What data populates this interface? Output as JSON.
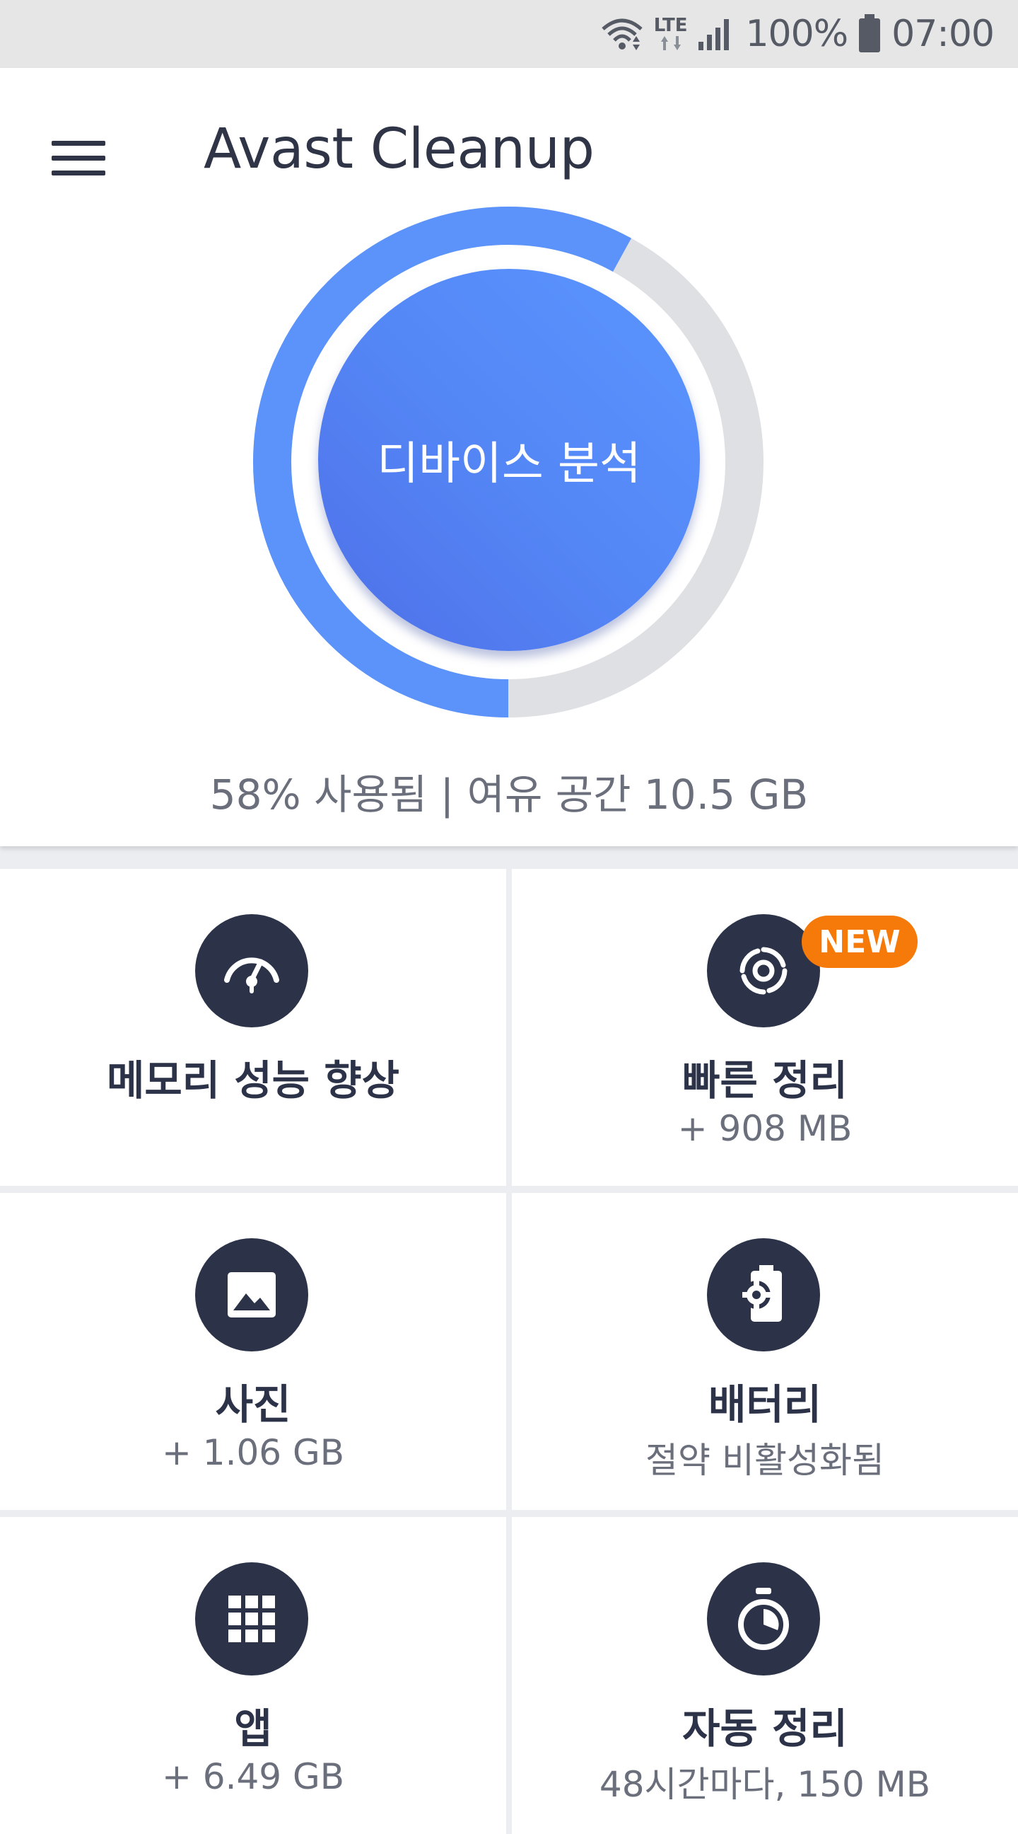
{
  "status_bar": {
    "network_label": "LTE",
    "battery_percent": "100%",
    "time": "07:00",
    "icons": [
      "wifi-icon",
      "lte-icon",
      "signal-icon",
      "battery-icon"
    ]
  },
  "header": {
    "title": "Avast Cleanup",
    "menu_icon": "hamburger-menu-icon"
  },
  "storage": {
    "used_fraction": 0.58,
    "analyze_button_label": "디바이스 분석",
    "summary": "58% 사용됨 | 여유 공간 10.5 GB",
    "colors": {
      "used": "#5b93fb",
      "free": "#dfe0e3",
      "button": "#5487f6"
    }
  },
  "tiles": [
    {
      "id": "memory",
      "title": "메모리 성능 향상",
      "subtitle": "",
      "icon": "speedometer-icon"
    },
    {
      "id": "quick-clean",
      "title": "빠른 정리",
      "subtitle": "+ 908 MB",
      "icon": "swirl-icon",
      "badge": "NEW"
    },
    {
      "id": "photos",
      "title": "사진",
      "subtitle": "+ 1.06 GB",
      "icon": "image-icon"
    },
    {
      "id": "battery",
      "title": "배터리",
      "subtitle": "절약 비활성화됨",
      "icon": "battery-gear-icon"
    },
    {
      "id": "apps",
      "title": "앱",
      "subtitle": "+ 6.49 GB",
      "icon": "app-grid-icon"
    },
    {
      "id": "auto-clean",
      "title": "자동 정리",
      "subtitle": "48시간마다, 150 MB",
      "icon": "stopwatch-icon"
    }
  ],
  "colors": {
    "accent_dark": "#2c3349",
    "badge": "#f57a0a"
  }
}
